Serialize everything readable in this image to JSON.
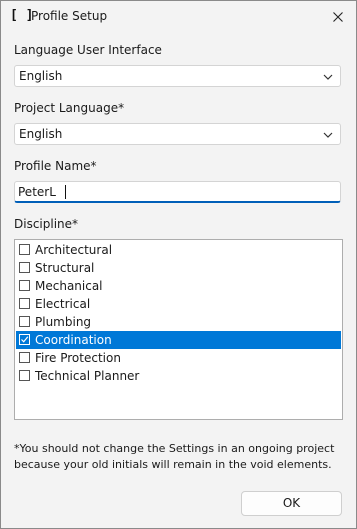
{
  "window": {
    "title": "Profile Setup",
    "app_icon": "bracket-app-icon",
    "close_icon": "close-icon"
  },
  "fields": {
    "language_ui": {
      "label": "Language User Interface",
      "value": "English"
    },
    "project_language": {
      "label": "Project Language*",
      "value": "English"
    },
    "profile_name": {
      "label": "Profile Name*",
      "value": "PeterL"
    },
    "discipline": {
      "label": "Discipline*",
      "items": [
        {
          "label": "Architectural",
          "checked": false,
          "selected": false
        },
        {
          "label": "Structural",
          "checked": false,
          "selected": false
        },
        {
          "label": "Mechanical",
          "checked": false,
          "selected": false
        },
        {
          "label": "Electrical",
          "checked": false,
          "selected": false
        },
        {
          "label": "Plumbing",
          "checked": false,
          "selected": false
        },
        {
          "label": "Coordination",
          "checked": true,
          "selected": true
        },
        {
          "label": "Fire Protection",
          "checked": false,
          "selected": false
        },
        {
          "label": "Technical Planner",
          "checked": false,
          "selected": false
        }
      ]
    }
  },
  "note": "*You should not change the Settings in an ongoing project because your old initials will remain in the void elements.",
  "buttons": {
    "ok": "OK"
  },
  "colors": {
    "accent": "#0078d7",
    "focus_underline": "#005fb8",
    "background": "#f3f3f3"
  }
}
